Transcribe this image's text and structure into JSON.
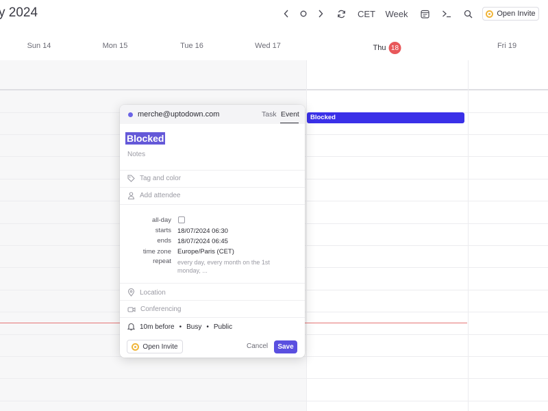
{
  "header": {
    "title": "y 2024",
    "timezone_btn": "CET",
    "view_btn": "Week",
    "open_invite_label": "Open Invite"
  },
  "days": [
    {
      "label": "Sun 14"
    },
    {
      "label": "Mon 15"
    },
    {
      "label": "Tue 16"
    },
    {
      "label": "Wed 17"
    },
    {
      "label": "Thu",
      "badge": "18",
      "today": true
    },
    {
      "label": "Fri 19"
    }
  ],
  "calendar": {
    "event_chip": "Blocked",
    "colors": {
      "event": "#3a30e8",
      "now_line": "#e57373",
      "today_badge": "#e8575a"
    }
  },
  "popover": {
    "account": "merche@uptodown.com",
    "tabs": {
      "task": "Task",
      "event": "Event",
      "selected": "Event"
    },
    "title": "Blocked",
    "notes_placeholder": "Notes",
    "tag_placeholder": "Tag and color",
    "attendee_placeholder": "Add attendee",
    "fields": {
      "allday_label": "all-day",
      "starts_label": "starts",
      "starts_value": "18/07/2024 06:30",
      "ends_label": "ends",
      "ends_value": "18/07/2024 06:45",
      "timezone_label": "time zone",
      "timezone_value": "Europe/Paris (CET)",
      "repeat_label": "repeat",
      "repeat_value": "every day, every month on the 1st monday, ..."
    },
    "location_placeholder": "Location",
    "conferencing_placeholder": "Conferencing",
    "alert": {
      "reminder": "10m before",
      "busy": "Busy",
      "visibility": "Public",
      "dot": "•"
    },
    "footer": {
      "open_invite": "Open Invite",
      "cancel": "Cancel",
      "save": "Save"
    },
    "colors": {
      "save": "#5a4fe0",
      "title_highlight": "#6458d8",
      "account_dot": "#6b63e6"
    }
  }
}
